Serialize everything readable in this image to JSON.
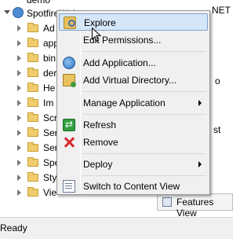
{
  "tree": {
    "top_item_partial": "demo",
    "site_name": "SpotfireWeb",
    "folders": [
      "Ad",
      "app",
      "bin",
      "der",
      "He",
      "Im",
      "Scr",
      "Ser",
      "Ser",
      "Spe",
      "Sty",
      "Vie"
    ]
  },
  "right_panel": {
    "fragment_1": "NET",
    "fragment_2": "o",
    "fragment_3": "st",
    "features_view_label": "Features View"
  },
  "status_bar": {
    "text": "Ready"
  },
  "context_menu": {
    "items": [
      {
        "label": "Explore",
        "icon": "explore-icon",
        "highlighted": true
      },
      {
        "label": "Edit Permissions...",
        "icon": ""
      },
      {
        "label": "Add Application...",
        "icon": "add-application-icon"
      },
      {
        "label": "Add Virtual Directory...",
        "icon": "add-virtual-directory-icon"
      },
      {
        "label": "Manage Application",
        "icon": "",
        "submenu": true
      },
      {
        "label": "Refresh",
        "icon": "refresh-icon"
      },
      {
        "label": "Remove",
        "icon": "remove-icon"
      },
      {
        "label": "Deploy",
        "icon": "",
        "submenu": true
      },
      {
        "label": "Switch to Content View",
        "icon": "switch-content-view-icon"
      }
    ]
  },
  "colors": {
    "menu_background": "#f0f0f0",
    "highlight_background": "#d5e6f8",
    "highlight_border": "#7da2ce",
    "folder_yellow": "#f0cc6d"
  }
}
